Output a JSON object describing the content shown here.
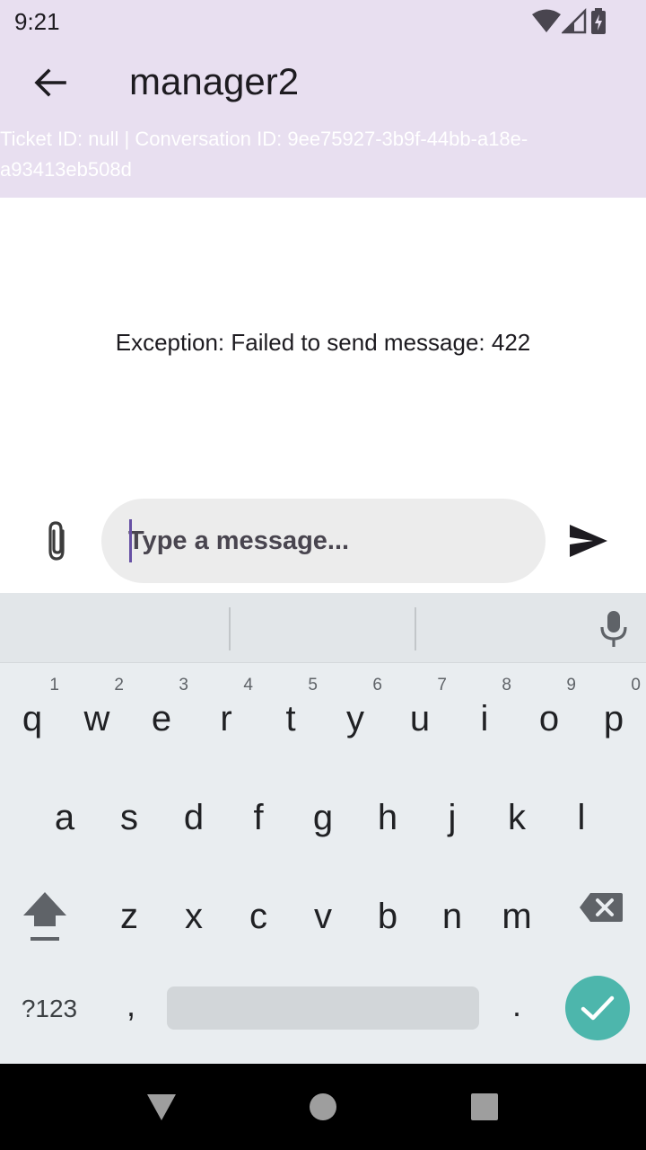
{
  "status_bar": {
    "time": "9:21",
    "icons": [
      "wifi-icon",
      "cellular-signal-icon",
      "battery-charging-icon"
    ]
  },
  "app_bar": {
    "title": "manager2",
    "subtitle": "Ticket ID: null | Conversation ID: 9ee75927-3b9f-44bb-a18e-a93413eb508d",
    "background": "#e8dff0"
  },
  "main": {
    "error_message": "Exception: Failed to send message: 422"
  },
  "composer": {
    "placeholder": "Type a message...",
    "value": "",
    "attach_icon": "paperclip-icon",
    "send_icon": "send-icon"
  },
  "keyboard": {
    "rows": [
      [
        {
          "letter": "q",
          "hint": "1"
        },
        {
          "letter": "w",
          "hint": "2"
        },
        {
          "letter": "e",
          "hint": "3"
        },
        {
          "letter": "r",
          "hint": "4"
        },
        {
          "letter": "t",
          "hint": "5"
        },
        {
          "letter": "y",
          "hint": "6"
        },
        {
          "letter": "u",
          "hint": "7"
        },
        {
          "letter": "i",
          "hint": "8"
        },
        {
          "letter": "o",
          "hint": "9"
        },
        {
          "letter": "p",
          "hint": "0"
        }
      ],
      [
        {
          "letter": "a",
          "hint": ""
        },
        {
          "letter": "s",
          "hint": ""
        },
        {
          "letter": "d",
          "hint": ""
        },
        {
          "letter": "f",
          "hint": ""
        },
        {
          "letter": "g",
          "hint": ""
        },
        {
          "letter": "h",
          "hint": ""
        },
        {
          "letter": "j",
          "hint": ""
        },
        {
          "letter": "k",
          "hint": ""
        },
        {
          "letter": "l",
          "hint": ""
        }
      ],
      [
        {
          "letter": "z",
          "hint": ""
        },
        {
          "letter": "x",
          "hint": ""
        },
        {
          "letter": "c",
          "hint": ""
        },
        {
          "letter": "v",
          "hint": ""
        },
        {
          "letter": "b",
          "hint": ""
        },
        {
          "letter": "n",
          "hint": ""
        },
        {
          "letter": "m",
          "hint": ""
        }
      ]
    ],
    "symbols_label": "?123",
    "comma_label": ",",
    "period_label": ".",
    "enter_color": "#4db6ac"
  },
  "nav_bar": {
    "icons": [
      "back-triangle-icon",
      "home-circle-icon",
      "recents-square-icon"
    ]
  }
}
